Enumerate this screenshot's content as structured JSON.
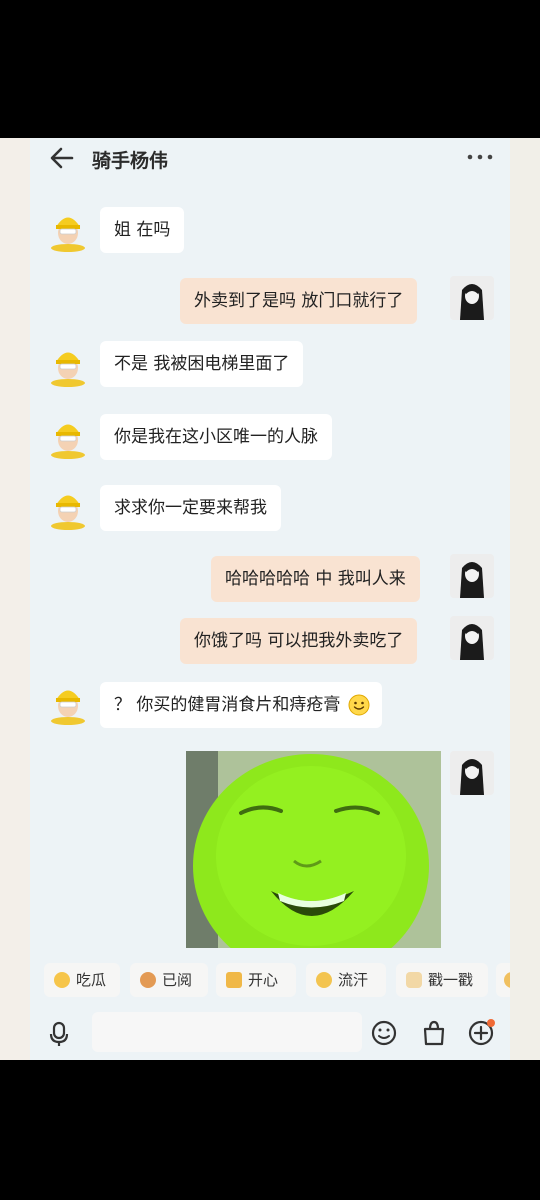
{
  "header": {
    "title": "骑手杨伟"
  },
  "messages": [
    {
      "side": "left",
      "text": "姐 在吗"
    },
    {
      "side": "right",
      "text": "外卖到了是吗 放门口就行了"
    },
    {
      "side": "left",
      "text": "不是 我被困电梯里面了"
    },
    {
      "side": "left",
      "text": "你是我在这小区唯一的人脉"
    },
    {
      "side": "left",
      "text": "求求你一定要来帮我"
    },
    {
      "side": "right",
      "text": "哈哈哈哈哈 中 我叫人来"
    },
    {
      "side": "right",
      "text": "你饿了吗 可以把我外卖吃了"
    },
    {
      "side": "left",
      "text": "？ 你买的健胃消食片和痔疮膏"
    }
  ],
  "quick_replies": [
    "吃瓜",
    "已阅",
    "开心",
    "流汗",
    "戳一戳"
  ],
  "icons": {
    "back": "arrow-left-icon",
    "more": "more-dots-icon",
    "mic": "microphone-icon",
    "emoji": "emoji-icon",
    "bag": "shopping-bag-icon",
    "plus": "plus-circle-icon"
  },
  "colors": {
    "bubble_right": "#f9e3d2",
    "bubble_left": "#ffffff",
    "notify_dot": "#f06a35"
  }
}
